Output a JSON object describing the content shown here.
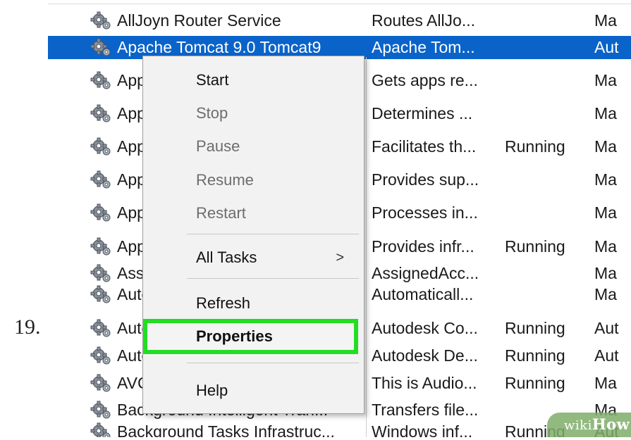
{
  "step": {
    "number": "19."
  },
  "services": [
    {
      "name": "AllJoyn Router Service",
      "description": "Routes AllJo...",
      "status": "",
      "startup": "Ma"
    },
    {
      "name": "Apache Tomcat 9.0 Tomcat9",
      "description": "Apache Tom...",
      "status": "",
      "startup": "Aut",
      "selected": true
    },
    {
      "name": "App Readiness",
      "description": "Gets apps re...",
      "status": "",
      "startup": "Ma"
    },
    {
      "name": "Application Identity",
      "description": "Determines ...",
      "status": "",
      "startup": "Ma"
    },
    {
      "name": "Application Information",
      "description": "Facilitates th...",
      "status": "Running",
      "startup": "Ma"
    },
    {
      "name": "Application Layer Gateway Service",
      "description": "Provides sup...",
      "status": "",
      "startup": "Ma"
    },
    {
      "name": "Application Management",
      "description": "Processes in...",
      "status": "",
      "startup": "Ma"
    },
    {
      "name": "AppX Deployment Service",
      "description": "Provides infr...",
      "status": "Running",
      "startup": "Ma"
    },
    {
      "name": "AssignedAccessManager Service",
      "description": "AssignedAcc...",
      "status": "",
      "startup": "Ma"
    },
    {
      "name": "Auto Time Zone Updater",
      "description": "Automaticall...",
      "status": "",
      "startup": "Ma"
    },
    {
      "name": "Autodesk Content Service",
      "description": "Autodesk Co...",
      "status": "Running",
      "startup": "Aut"
    },
    {
      "name": "Autodesk Desktop App Service",
      "description": "Autodesk De...",
      "status": "Running",
      "startup": "Aut"
    },
    {
      "name": "AVCTP service",
      "description": "This is Audio...",
      "status": "Running",
      "startup": "Ma"
    },
    {
      "name": "Background Intelligent Tran...",
      "description": "Transfers file...",
      "status": "",
      "startup": "Ma"
    },
    {
      "name": "Background Tasks Infrastruc...",
      "description": "Windows inf...",
      "status": "Running",
      "startup": "Aut"
    }
  ],
  "context_menu": {
    "start": "Start",
    "stop": "Stop",
    "pause": "Pause",
    "resume": "Resume",
    "restart": "Restart",
    "all_tasks": "All Tasks",
    "all_tasks_arrow": ">",
    "refresh": "Refresh",
    "properties": "Properties",
    "help": "Help"
  },
  "watermark": {
    "wiki": "wiki",
    "how": "How"
  },
  "colors": {
    "selection": "#0a63c9",
    "highlight": "#22dd22",
    "menu_bg": "#f2f2f2"
  },
  "icons": {
    "service": "gear-icon"
  }
}
